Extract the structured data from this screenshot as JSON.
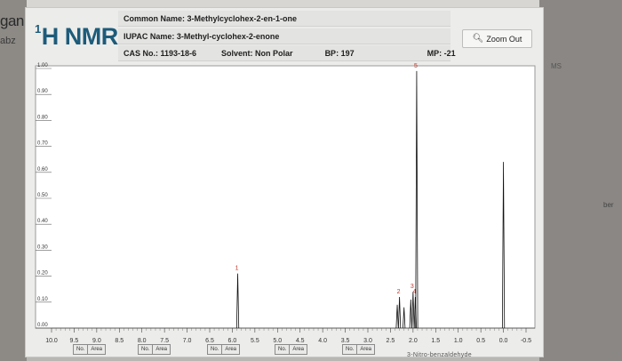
{
  "backdrop": {
    "left_fragment": "ganic",
    "left_fragment2": "abz",
    "right_fragment1": "MS",
    "right_fragment2": "ber",
    "footer_fragment": "3-Nitro-benzaldehyde"
  },
  "header": {
    "title_sup": "1",
    "title_main": "H NMR",
    "common_name": "Common Name: 3-Methylcyclohex-2-en-1-one",
    "iupac_name": "IUPAC Name: 3-Methyl-cyclohex-2-enone",
    "cas": "CAS No.: 1193-18-6",
    "solvent": "Solvent: Non Polar",
    "bp": "BP: 197",
    "mp": "MP: -21",
    "zoom_out": "Zoom Out",
    "zoom_icon": "magnifier-icon"
  },
  "area_buttons": [
    {
      "no": "No.",
      "area": "Area"
    },
    {
      "no": "No.",
      "area": "Area"
    },
    {
      "no": "No.",
      "area": "Area"
    },
    {
      "no": "No.",
      "area": "Area"
    },
    {
      "no": "No.",
      "area": "Area"
    }
  ],
  "chart_data": {
    "type": "line",
    "title": "",
    "xlabel": "",
    "ylabel": "",
    "xlim": [
      10.0,
      -0.5
    ],
    "ylim": [
      0.0,
      1.0
    ],
    "x_ticks": [
      "10.0",
      "9.5",
      "9.0",
      "8.5",
      "8.0",
      "7.5",
      "7.0",
      "6.5",
      "6.0",
      "5.5",
      "5.0",
      "4.5",
      "4.0",
      "3.5",
      "3.0",
      "2.5",
      "2.0",
      "1.5",
      "1.0",
      "0.5",
      "0.0",
      "-0.5"
    ],
    "y_ticks": [
      "0.00",
      "0.10",
      "0.20",
      "0.30",
      "0.40",
      "0.50",
      "0.60",
      "0.70",
      "0.80",
      "0.90",
      "1.00"
    ],
    "peaks": [
      {
        "ppm": 5.88,
        "height": 0.21,
        "label": "1"
      },
      {
        "ppm": 2.35,
        "height": 0.09,
        "label": ""
      },
      {
        "ppm": 2.3,
        "height": 0.12,
        "label": "2"
      },
      {
        "ppm": 2.2,
        "height": 0.08,
        "label": ""
      },
      {
        "ppm": 2.05,
        "height": 0.11,
        "label": ""
      },
      {
        "ppm": 2.0,
        "height": 0.14,
        "label": "3"
      },
      {
        "ppm": 1.95,
        "height": 0.12,
        "label": "4"
      },
      {
        "ppm": 1.92,
        "height": 0.99,
        "label": "5"
      },
      {
        "ppm": 0.0,
        "height": 0.64,
        "label": ""
      }
    ],
    "grid": false,
    "legend": "none"
  }
}
